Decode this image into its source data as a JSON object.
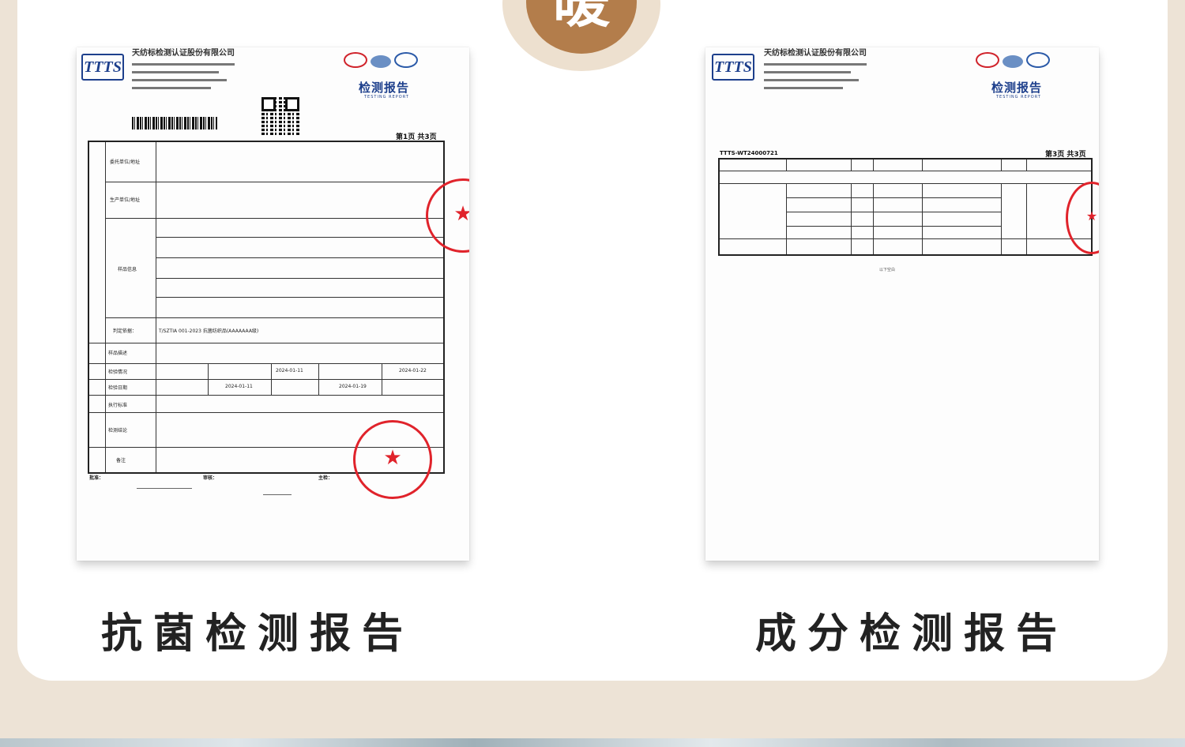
{
  "header": {
    "medallion_char": "暖"
  },
  "colors": {
    "background": "#ede3d6",
    "panel": "#ffffff",
    "medallion": "#b37d4b",
    "stamp_red": "#e0232b",
    "logo_blue": "#1d3f8c"
  },
  "documents": [
    {
      "caption": "抗菌检测报告",
      "logo": "TTTS",
      "org_name": "天纺标检测认证股份有限公司",
      "report_title": "检测报告",
      "report_subtitle": "TESTING REPORT",
      "page_no": "第1页 共3页",
      "fields": {
        "commissioner_label": "委托单位/地址",
        "producer_label": "生产单位/地址",
        "sample_info_label": "样品信息",
        "judgement_label": "判定依据：",
        "judgement_value": "T/SZTIA 001-2023 抗菌纺织品(AAAAAAA级)",
        "sample_desc_label": "样品描述",
        "test_situation_label": "检验情况",
        "test_date_label": "检验日期",
        "method_label": "执行标准",
        "conclusion_label": "检测结论",
        "remark_label": "备注",
        "date_1": "2024-01-11",
        "date_2": "2024-01-22",
        "date_3": "2024-01-11",
        "date_4": "2024-01-19"
      },
      "signatures": {
        "approve_label": "批准：",
        "review_label": "审核：",
        "main_label": "主检："
      }
    },
    {
      "caption": "成分检测报告",
      "logo": "TTTS",
      "org_name": "天纺标检测认证股份有限公司",
      "report_title": "检测报告",
      "report_subtitle": "TESTING REPORT",
      "page_no": "第3页 共3页",
      "serial": "TTTS-WT24000721",
      "footer": "以下空白"
    }
  ]
}
